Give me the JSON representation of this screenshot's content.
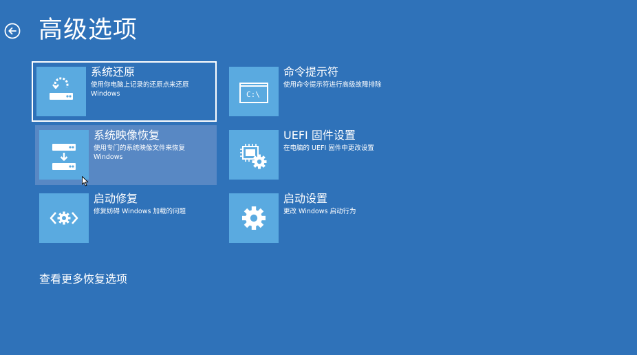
{
  "header": {
    "title": "高级选项",
    "back_icon": "circle-arrow-left-icon"
  },
  "options": [
    {
      "id": "system-restore",
      "title": "系统还原",
      "description": "使用你电脑上记录的还原点来还原\nWindows",
      "icon": "restore-drive-icon",
      "state": "focused"
    },
    {
      "id": "command-prompt",
      "title": "命令提示符",
      "description": "使用命令提示符进行高级故障排除",
      "icon": "command-prompt-icon",
      "icon_text": "C:\\",
      "state": "normal"
    },
    {
      "id": "system-image-recovery",
      "title": "系统映像恢复",
      "description": "使用专门的系统映像文件来恢复\nWindows",
      "icon": "image-recovery-drive-icon",
      "state": "hovered"
    },
    {
      "id": "uefi-firmware",
      "title": "UEFI 固件设置",
      "description": "在电脑的 UEFI 固件中更改设置",
      "icon": "chip-gear-icon",
      "state": "normal"
    },
    {
      "id": "startup-repair",
      "title": "启动修复",
      "description": "修复妨碍 Windows 加载的问题",
      "icon": "code-gear-icon",
      "state": "normal"
    },
    {
      "id": "startup-settings",
      "title": "启动设置",
      "description": "更改 Windows 启动行为",
      "icon": "gear-icon",
      "state": "normal"
    }
  ],
  "more_link": "查看更多恢复选项",
  "colors": {
    "background": "#2f72b9",
    "tile_icon": "#5aaae0",
    "hover": "#5888c4",
    "text": "#ffffff"
  }
}
